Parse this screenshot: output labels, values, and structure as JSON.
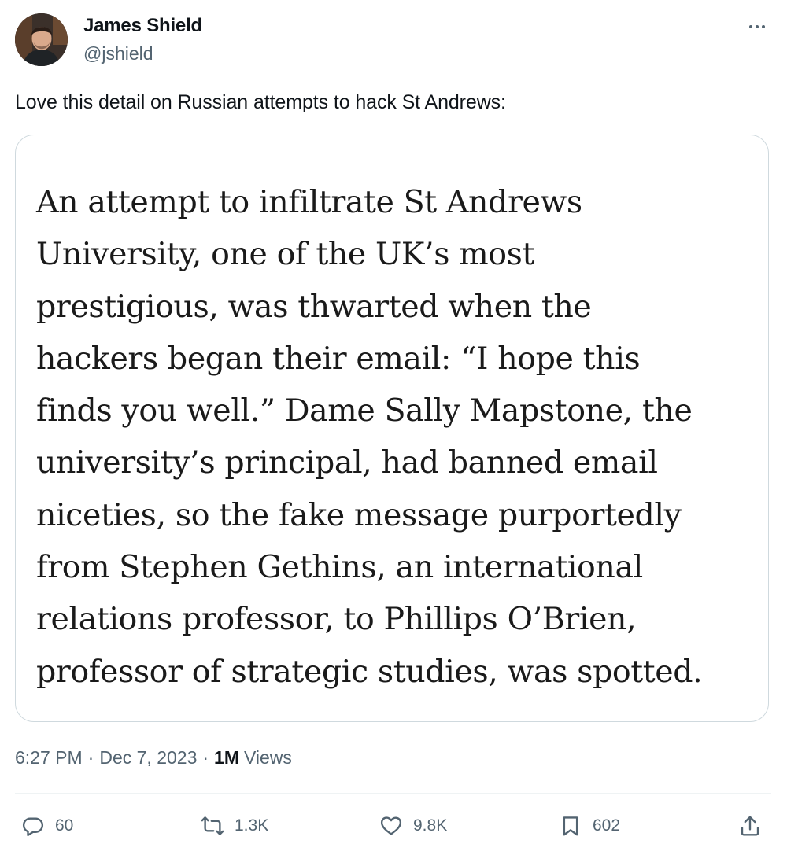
{
  "author": {
    "display_name": "James Shield",
    "handle": "@jshield"
  },
  "tweet": {
    "text": "Love this detail on Russian attempts to hack St Andrews:",
    "quote_lines": [
      "An attempt to infiltrate St Andrews",
      "University, one of the UK’s most",
      "prestigious, was thwarted when the",
      "hackers began their email: “I hope this",
      "finds you well.” Dame Sally Mapstone, the",
      "university’s principal, had banned email",
      "niceties, so the fake message purportedly",
      "from Stephen Gethins, an international",
      "relations professor, to Phillips O’Brien,",
      "professor of strategic studies, was spotted."
    ]
  },
  "meta": {
    "time": "6:27 PM",
    "separator_1": "·",
    "date": "Dec 7, 2023",
    "separator_2": "·",
    "views_count": "1M",
    "views_label": "Views"
  },
  "actions": {
    "replies": "60",
    "reposts": "1.3K",
    "likes": "9.8K",
    "bookmarks": "602"
  },
  "icons": {
    "more": "more-horizontal-icon",
    "reply": "reply-icon",
    "repost": "repost-icon",
    "like": "heart-icon",
    "bookmark": "bookmark-icon",
    "share": "share-icon"
  },
  "colors": {
    "text_primary": "#0f1419",
    "text_secondary": "#536471",
    "border": "#cfd9de"
  }
}
